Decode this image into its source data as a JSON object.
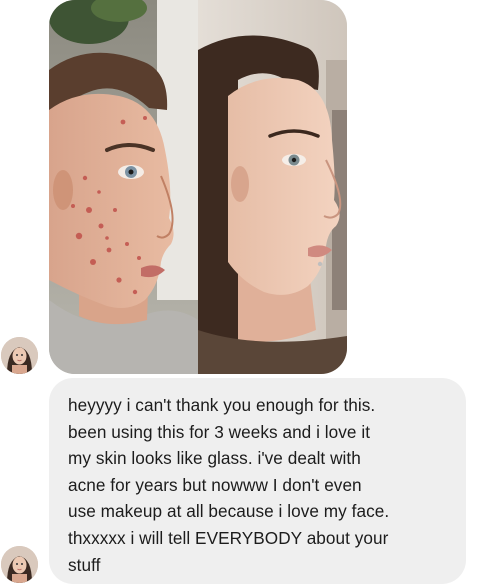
{
  "conversation": {
    "attachment": {
      "icon": "before-after-photo"
    },
    "message": {
      "lines": [
        "heyyyy i can't thank you enough for this.",
        "been using this for 3 weeks and i love it",
        "my skin looks like glass. i've dealt with",
        "acne for years but nowww I don't even",
        "use makeup at all because i love my face.",
        "thxxxxx i will tell EVERYBODY about your",
        "stuff"
      ]
    },
    "sender": {
      "avatar_icon": "user-avatar"
    }
  },
  "colors": {
    "bubble_background": "#efefef",
    "text": "#1c1c1c",
    "page_background": "#ffffff"
  }
}
